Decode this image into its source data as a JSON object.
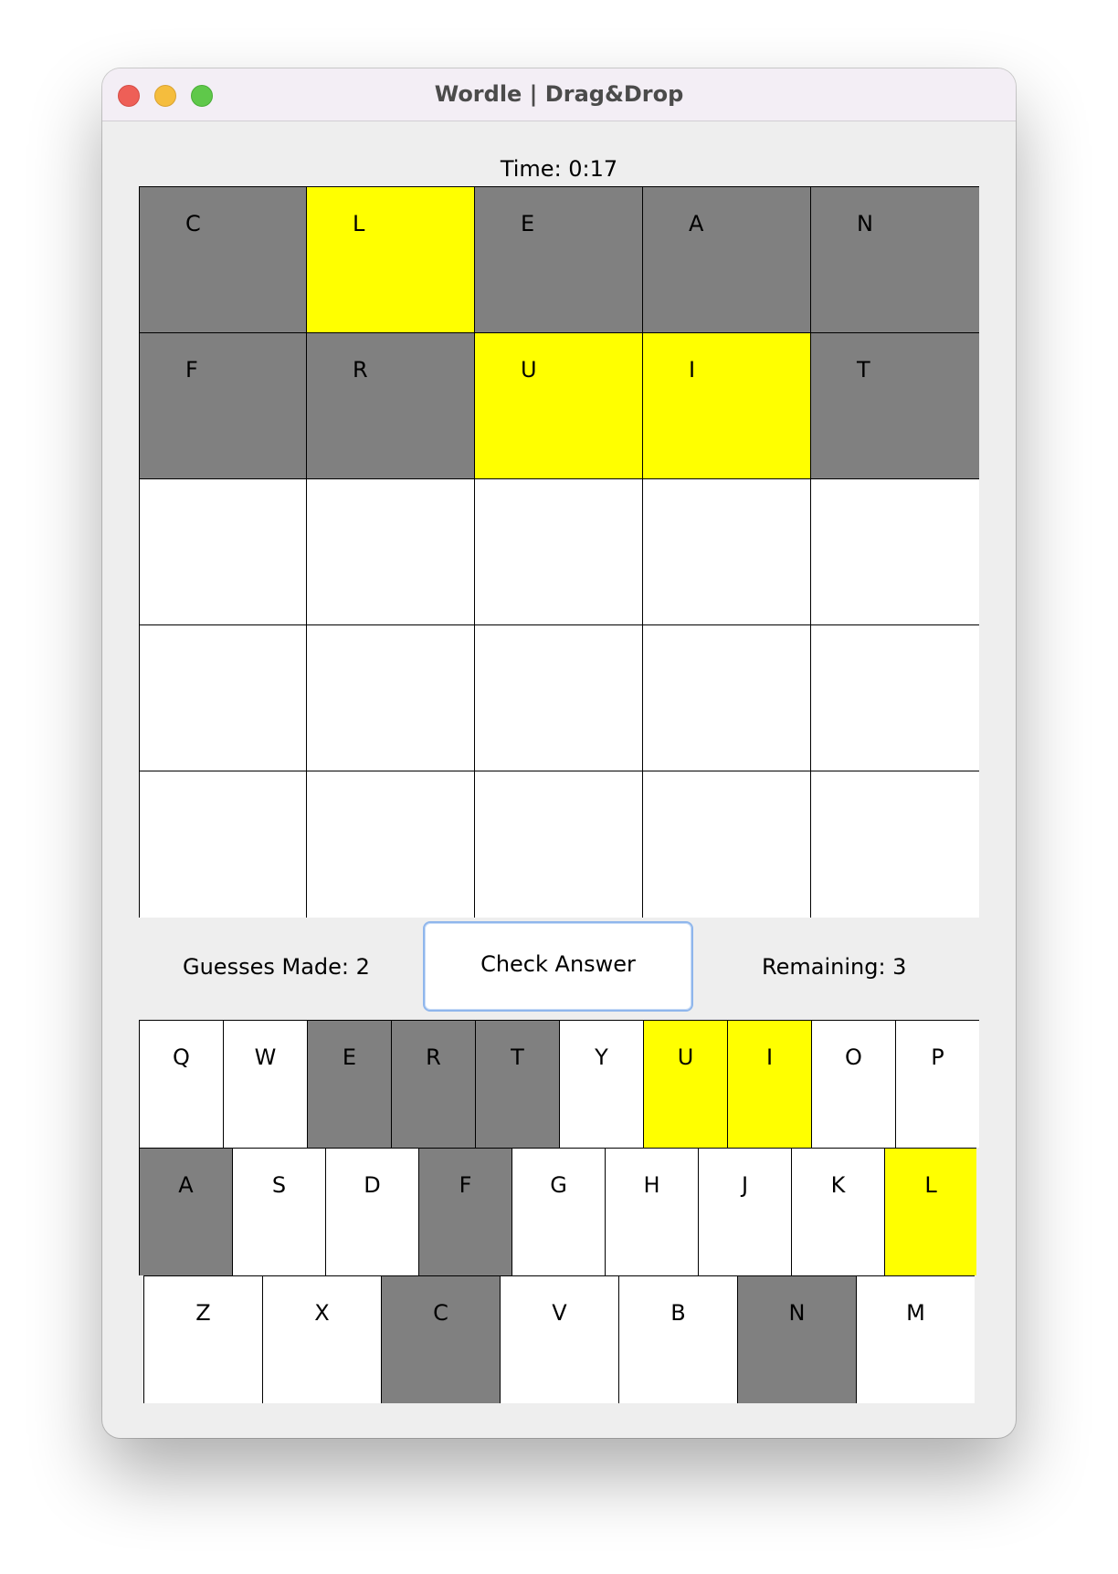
{
  "window": {
    "title": "Wordle | Drag&Drop"
  },
  "timer": {
    "text": "Time: 0:17"
  },
  "board": {
    "rows": [
      [
        {
          "letter": "C",
          "state": "absent"
        },
        {
          "letter": "L",
          "state": "present"
        },
        {
          "letter": "E",
          "state": "absent"
        },
        {
          "letter": "A",
          "state": "absent"
        },
        {
          "letter": "N",
          "state": "absent"
        }
      ],
      [
        {
          "letter": "F",
          "state": "absent"
        },
        {
          "letter": "R",
          "state": "absent"
        },
        {
          "letter": "U",
          "state": "present"
        },
        {
          "letter": "I",
          "state": "present"
        },
        {
          "letter": "T",
          "state": "absent"
        }
      ],
      [
        {
          "letter": "",
          "state": "empty"
        },
        {
          "letter": "",
          "state": "empty"
        },
        {
          "letter": "",
          "state": "empty"
        },
        {
          "letter": "",
          "state": "empty"
        },
        {
          "letter": "",
          "state": "empty"
        }
      ],
      [
        {
          "letter": "",
          "state": "empty"
        },
        {
          "letter": "",
          "state": "empty"
        },
        {
          "letter": "",
          "state": "empty"
        },
        {
          "letter": "",
          "state": "empty"
        },
        {
          "letter": "",
          "state": "empty"
        }
      ],
      [
        {
          "letter": "",
          "state": "empty"
        },
        {
          "letter": "",
          "state": "empty"
        },
        {
          "letter": "",
          "state": "empty"
        },
        {
          "letter": "",
          "state": "empty"
        },
        {
          "letter": "",
          "state": "empty"
        }
      ]
    ]
  },
  "status": {
    "guesses_made": "Guesses Made: 2",
    "remaining": "Remaining: 3",
    "check_button": "Check Answer"
  },
  "keyboard": {
    "rows": [
      [
        {
          "letter": "Q",
          "state": "unused"
        },
        {
          "letter": "W",
          "state": "unused"
        },
        {
          "letter": "E",
          "state": "absent"
        },
        {
          "letter": "R",
          "state": "absent"
        },
        {
          "letter": "T",
          "state": "absent"
        },
        {
          "letter": "Y",
          "state": "unused"
        },
        {
          "letter": "U",
          "state": "present"
        },
        {
          "letter": "I",
          "state": "present"
        },
        {
          "letter": "O",
          "state": "unused"
        },
        {
          "letter": "P",
          "state": "unused"
        }
      ],
      [
        {
          "letter": "A",
          "state": "absent"
        },
        {
          "letter": "S",
          "state": "unused"
        },
        {
          "letter": "D",
          "state": "unused"
        },
        {
          "letter": "F",
          "state": "absent"
        },
        {
          "letter": "G",
          "state": "unused"
        },
        {
          "letter": "H",
          "state": "unused"
        },
        {
          "letter": "J",
          "state": "unused"
        },
        {
          "letter": "K",
          "state": "unused"
        },
        {
          "letter": "L",
          "state": "present"
        }
      ],
      [
        {
          "letter": "Z",
          "state": "unused"
        },
        {
          "letter": "X",
          "state": "unused"
        },
        {
          "letter": "C",
          "state": "absent"
        },
        {
          "letter": "V",
          "state": "unused"
        },
        {
          "letter": "B",
          "state": "unused"
        },
        {
          "letter": "N",
          "state": "absent"
        },
        {
          "letter": "M",
          "state": "unused"
        }
      ]
    ]
  },
  "colors": {
    "absent": "#808080",
    "present": "#ffff00",
    "empty": "#ffffff",
    "window_bg": "#eeeeee",
    "button_focus_ring": "#8fb6ec"
  }
}
